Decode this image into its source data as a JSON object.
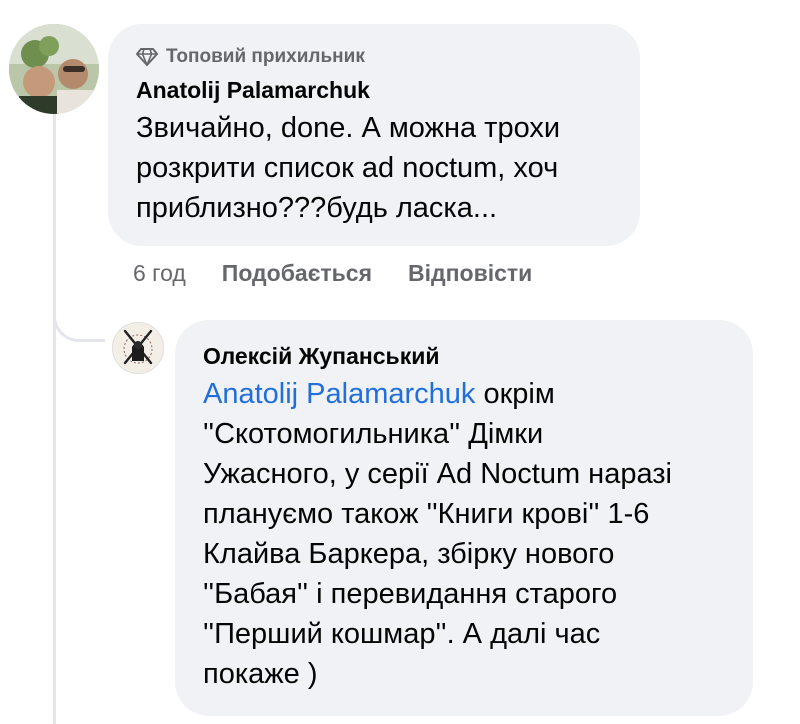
{
  "comment": {
    "badge": "Топовий прихильник",
    "badge_icon": "diamond-icon",
    "author": "Anatolij Palamarchuk",
    "lines": [
      "Звичайно, done. А можна трохи",
      "розкрити список ad noctum, хоч",
      "приблизно???будь ласка..."
    ],
    "time": "6 год",
    "like_label": "Подобається",
    "reply_label": "Відповісти"
  },
  "reply": {
    "author": "Олексій Жупанський",
    "mention": "Anatolij Palamarchuk",
    "first_line_rest": " окрім",
    "lines": [
      "''Скотомогильника'' Дімки",
      "Ужасного, у серії Ad Noctum наразі",
      "плануємо також ''Книги крові'' 1-6",
      "Клайва Баркера, збірку нового",
      "''Бабая'' і перевидання старого",
      "''Перший кошмар''. А далі час",
      "покаже )"
    ]
  },
  "colors": {
    "bubble": "#f0f2f5",
    "mention": "#216fdb",
    "secondary_text": "#65676b"
  }
}
